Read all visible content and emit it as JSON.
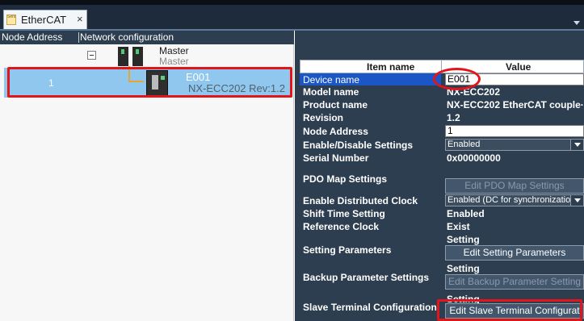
{
  "tab": {
    "label": "EtherCAT",
    "close": "×",
    "icon_text": "Serial",
    "icon": "ethercat-doc-icon"
  },
  "left": {
    "col_node_address": "Node Address",
    "col_network_config": "Network configuration",
    "master": {
      "label": "Master",
      "sublabel": "Master"
    },
    "device": {
      "node": "1",
      "name": "E001",
      "model": "NX-ECC202 Rev:1.2"
    }
  },
  "grid": {
    "header_item": "Item name",
    "header_value": "Value",
    "rows": {
      "device_name": {
        "name": "Device name",
        "value": "E001"
      },
      "model_name": {
        "name": "Model name",
        "value": "NX-ECC202"
      },
      "product_name": {
        "name": "Product name",
        "value": "NX-ECC202 EtherCAT couple···"
      },
      "revision": {
        "name": "Revision",
        "value": "1.2"
      },
      "node_address": {
        "name": "Node Address",
        "value": "1"
      },
      "enable_disable": {
        "name": "Enable/Disable Settings",
        "value": "Enabled"
      },
      "serial_number": {
        "name": "Serial Number",
        "value": "0x00000000"
      },
      "pdo_map": {
        "name": "PDO Map Settings",
        "button": "Edit PDO Map Settings"
      },
      "distributed_clock": {
        "name": "Enable Distributed Clock",
        "value": "Enabled (DC for synchronizatio"
      },
      "shift_time": {
        "name": "Shift Time Setting",
        "value": "Enabled"
      },
      "reference_clock": {
        "name": "Reference Clock",
        "value": "Exist"
      },
      "setting_params": {
        "name": "Setting Parameters",
        "caption": "Setting",
        "button": "Edit Setting Parameters"
      },
      "backup_params": {
        "name": "Backup Parameter Settings",
        "caption": "Setting",
        "button": "Edit Backup Parameter Setting"
      },
      "slave_terminal": {
        "name": "Slave Terminal Configuration",
        "caption": "Setting",
        "button": "Edit Slave Terminal Configurat"
      }
    }
  },
  "colors": {
    "panel": "#2d3e50",
    "selection": "#8fc7ee",
    "annotation_red": "#e3151b",
    "row_select": "#1a56c6"
  }
}
